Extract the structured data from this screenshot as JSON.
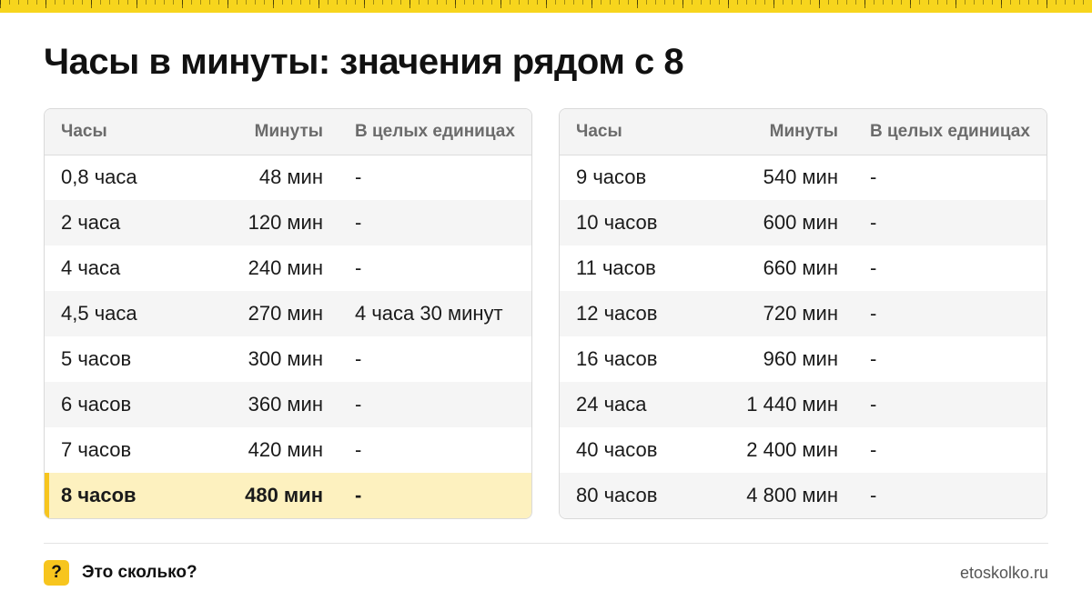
{
  "page": {
    "title": "Часы в минуты: значения рядом с 8"
  },
  "table_headers": [
    "Часы",
    "Минуты",
    "В целых единицах"
  ],
  "left_table": [
    [
      "0,8 часа",
      "48 мин",
      "-"
    ],
    [
      "2 часа",
      "120 мин",
      "-"
    ],
    [
      "4 часа",
      "240 мин",
      "-"
    ],
    [
      "4,5 часа",
      "270 мин",
      "4 часа 30 минут"
    ],
    [
      "5 часов",
      "300 мин",
      "-"
    ],
    [
      "6 часов",
      "360 мин",
      "-"
    ],
    [
      "7 часов",
      "420 мин",
      "-"
    ],
    [
      "8 часов",
      "480 мин",
      "-"
    ]
  ],
  "right_table": [
    [
      "9 часов",
      "540 мин",
      "-"
    ],
    [
      "10 часов",
      "600 мин",
      "-"
    ],
    [
      "11 часов",
      "660 мин",
      "-"
    ],
    [
      "12 часов",
      "720 мин",
      "-"
    ],
    [
      "16 часов",
      "960 мин",
      "-"
    ],
    [
      "24 часа",
      "1 440 мин",
      "-"
    ],
    [
      "40 часов",
      "2 400 мин",
      "-"
    ],
    [
      "80 часов",
      "4 800 мин",
      "-"
    ]
  ],
  "highlight_color": "#fdf1bf",
  "accent_color": "#f7c51e",
  "footer": {
    "logo_glyph": "?",
    "brand": "Это сколько?",
    "site": "etoskolko.ru"
  }
}
